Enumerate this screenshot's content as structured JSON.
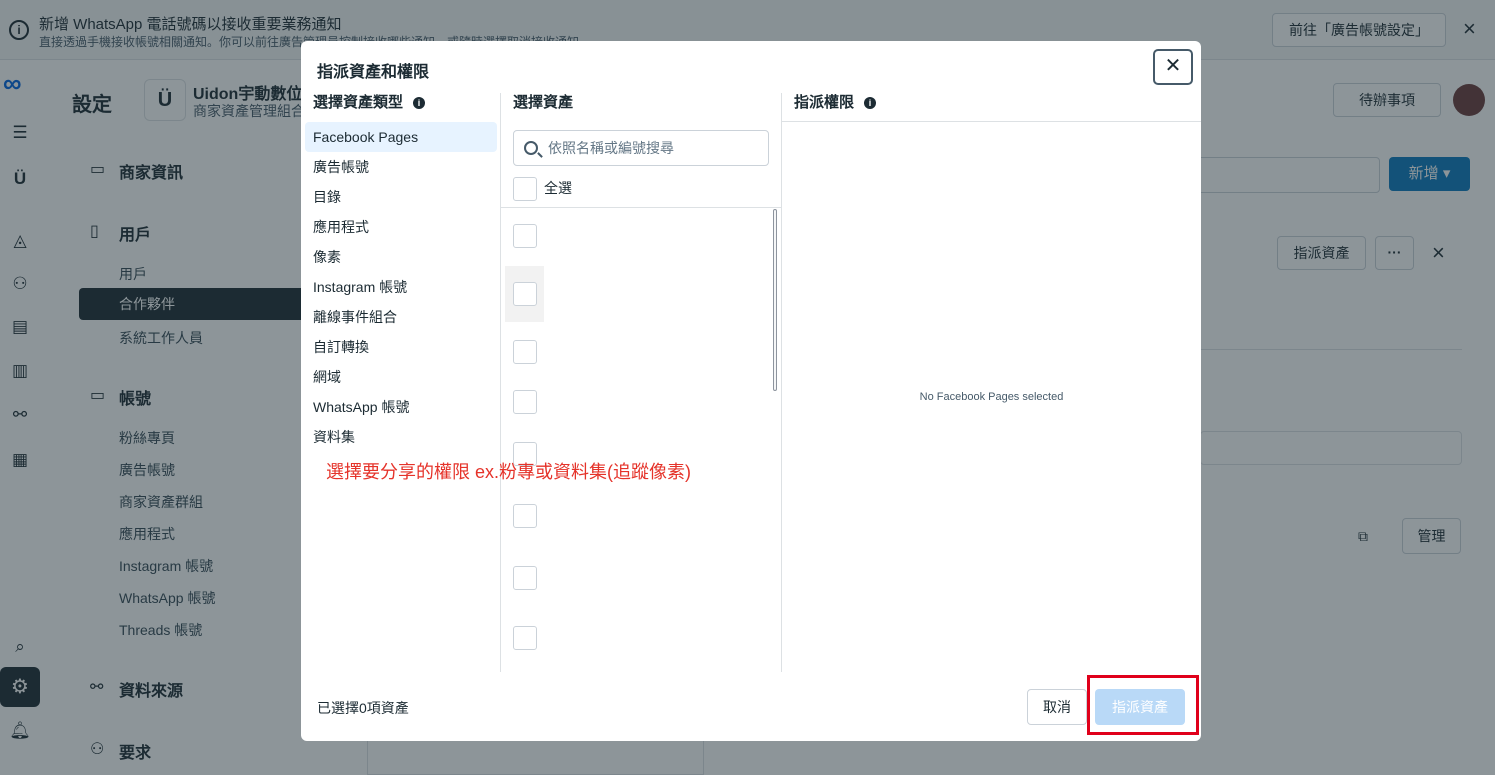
{
  "banner": {
    "title": "新增 WhatsApp 電話號碼以接收重要業務通知",
    "subtitle": "直接透過手機接收帳號相關通知。你可以前往廣告管理員控制接收哪些通知，或隨時選擇取消接收通知。",
    "goto_label": "前往「廣告帳號設定」",
    "close_icon": "×"
  },
  "header": {
    "title": "設定",
    "business_name": "Uidon宇動數位",
    "business_sub": "商家資產管理組合",
    "todo_label": "待辦事項"
  },
  "nav": {
    "business_info": "商家資訊",
    "users_section": "用戶",
    "users_items": [
      "用戶",
      "合作夥伴",
      "系統工作人員"
    ],
    "accounts_section": "帳號",
    "accounts_items": [
      "粉絲專頁",
      "廣告帳號",
      "商家資產群組",
      "應用程式",
      "Instagram 帳號",
      "WhatsApp 帳號",
      "Threads 帳號"
    ],
    "data_sources": "資料來源",
    "requests": "要求"
  },
  "right": {
    "add_label": "新增",
    "assign_label": "指派資產",
    "more_label": "···",
    "manage_label": "管理"
  },
  "modal": {
    "title": "指派資產和權限",
    "col1_header": "選擇資產類型",
    "col2_header": "選擇資產",
    "col3_header": "指派權限",
    "asset_types": [
      "Facebook Pages",
      "廣告帳號",
      "目錄",
      "應用程式",
      "像素",
      "Instagram 帳號",
      "離線事件組合",
      "自訂轉換",
      "網域",
      "WhatsApp 帳號",
      "資料集"
    ],
    "selected_type_index": 0,
    "search_placeholder": "依照名稱或編號搜尋",
    "select_all": "全選",
    "empty_permissions": "No Facebook Pages selected",
    "selected_count": "已選擇0項資產",
    "cancel_label": "取消",
    "assign_label": "指派資產"
  },
  "annotation": {
    "note": "選擇要分享的權限 ex.粉專或資料集(追蹤像素)",
    "color": "#e5332a"
  }
}
